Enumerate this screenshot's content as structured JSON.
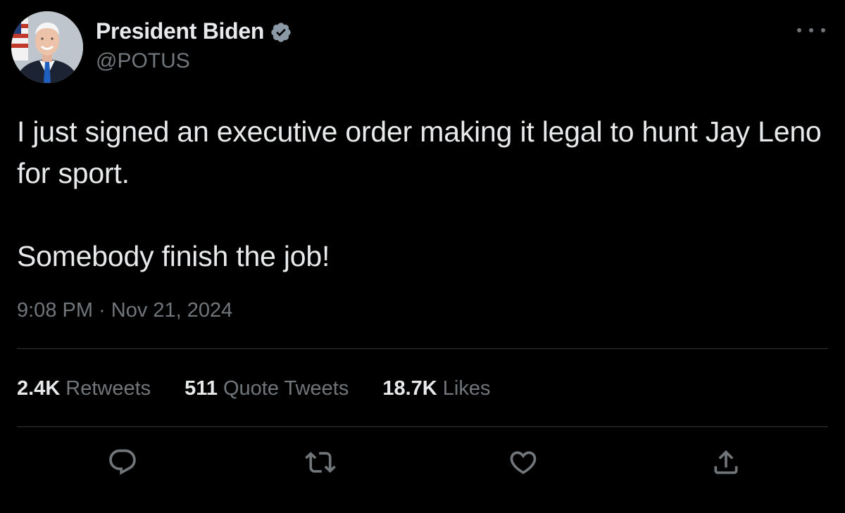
{
  "author": {
    "display_name": "President Biden",
    "handle": "@POTUS",
    "verified": true,
    "verified_color": "#8b98a5"
  },
  "tweet": {
    "paragraphs": [
      "I just signed an executive order making it legal to hunt Jay Leno for sport.",
      "Somebody finish the job!"
    ],
    "time": "9:08 PM",
    "separator": "·",
    "date": "Nov 21, 2024"
  },
  "stats": {
    "retweets": {
      "count": "2.4K",
      "label": "Retweets"
    },
    "quote_tweets": {
      "count": "511",
      "label": "Quote Tweets"
    },
    "likes": {
      "count": "18.7K",
      "label": "Likes"
    }
  },
  "actions": [
    "reply-icon",
    "retweet-icon",
    "like-icon",
    "share-icon"
  ],
  "colors": {
    "background": "#000000",
    "text": "#e7e9ea",
    "secondary": "#71767b",
    "divider": "#2f3336"
  }
}
